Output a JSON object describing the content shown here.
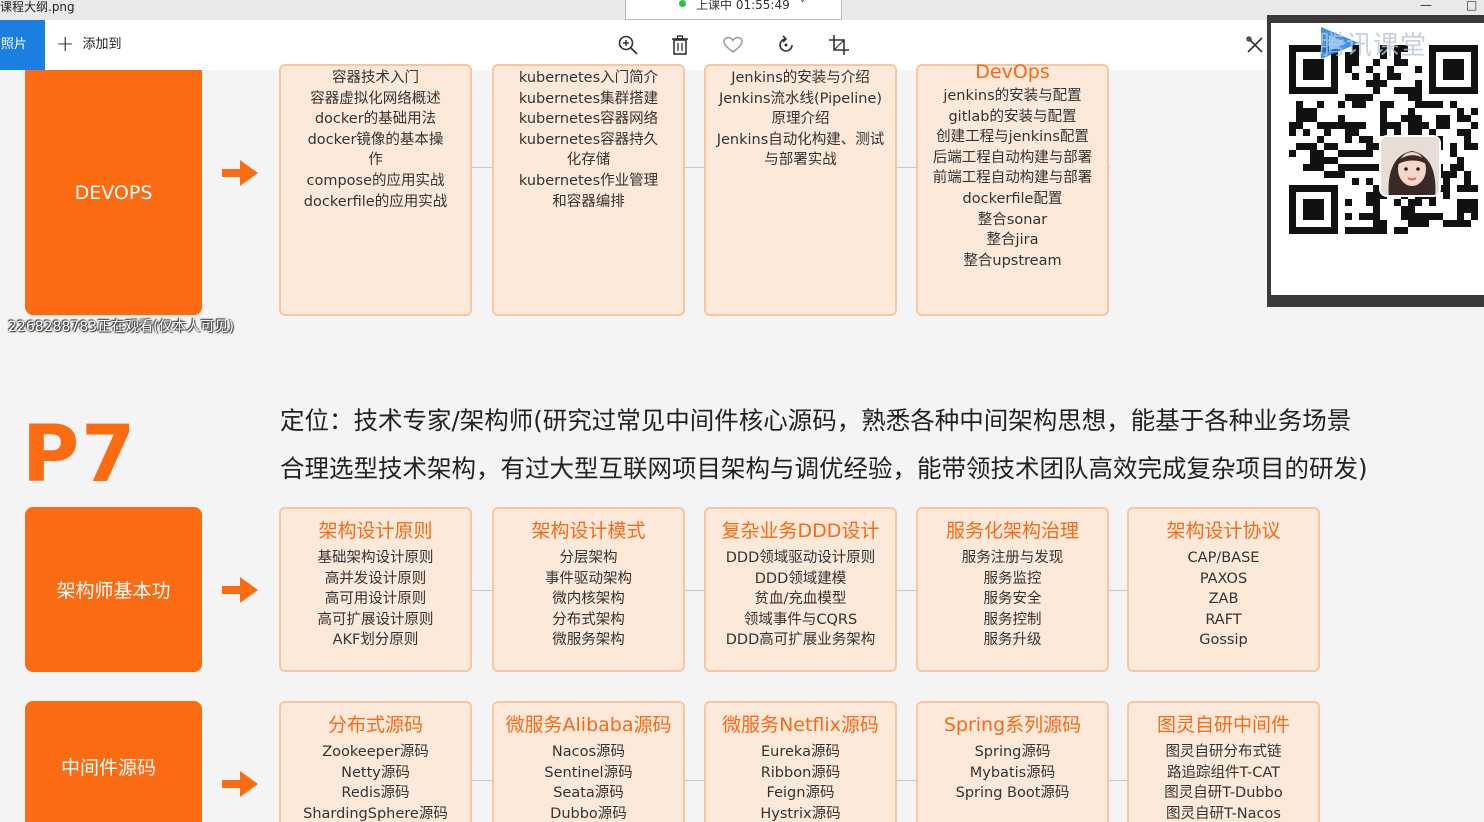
{
  "window": {
    "filename": "课程大纲.png",
    "minimize_glyph": "—",
    "maximize_glyph": "□"
  },
  "live": {
    "status": "上课中 01:55:49",
    "chevron": "˅"
  },
  "toolbar": {
    "tab_label": "有照片",
    "add_label": "添加到",
    "icons": [
      "zoom-in-icon",
      "trash-icon",
      "heart-icon",
      "rotate-icon",
      "crop-icon",
      "edit-icon"
    ]
  },
  "viewer_note": "2268288783正在观看(仅本人可见)",
  "qr_panel": {
    "brand": "腾讯课堂",
    "accent": "#1a7fe0"
  },
  "devops_row": {
    "label": "DEVOPS",
    "cards": [
      {
        "title": "",
        "items": [
          "容器技术入门",
          "容器虚拟化网络概述",
          "docker的基础用法",
          "docker镜像的基本操",
          "作",
          "compose的应用实战",
          "dockerfile的应用实战"
        ]
      },
      {
        "title": "",
        "items": [
          "kubernetes入门简介",
          "kubernetes集群搭建",
          "kubernetes容器网络",
          "kubernetes容器持久",
          "化存储",
          "kubernetes作业管理",
          "和容器编排"
        ]
      },
      {
        "title": "",
        "items": [
          "Jenkins的安装与介绍",
          "Jenkins流水线(Pipeline)",
          "原理介绍",
          "Jenkins自动化构建、测试",
          "与部署实战"
        ]
      },
      {
        "title": "DevOps",
        "items": [
          "jenkins的安装与配置",
          "gitlab的安装与配置",
          "创建工程与jenkins配置",
          "后端工程自动构建与部署",
          "前端工程自动构建与部署",
          "dockerfile配置",
          "整合sonar",
          "整合jira",
          "整合upstream"
        ]
      }
    ]
  },
  "level": {
    "name": "P7",
    "description_line1": "定位：技术专家/架构师(研究过常见中间件核心源码，熟悉各种中间架构思想，能基于各种业务场景",
    "description_line2": "合理选型技术架构，有过大型互联网项目架构与调优经验，能带领技术团队高效完成复杂项目的研发)"
  },
  "architect_row": {
    "label": "架构师基本功",
    "cards": [
      {
        "title": "架构设计原则",
        "items": [
          "基础架构设计原则",
          "高并发设计原则",
          "高可用设计原则",
          "高可扩展设计原则",
          "AKF划分原则"
        ]
      },
      {
        "title": "架构设计模式",
        "items": [
          "分层架构",
          "事件驱动架构",
          "微内核架构",
          "分布式架构",
          "微服务架构"
        ]
      },
      {
        "title": "复杂业务DDD设计",
        "items": [
          "DDD领域驱动设计原则",
          "DDD领域建模",
          "贫血/充血模型",
          "领域事件与CQRS",
          "DDD高可扩展业务架构"
        ]
      },
      {
        "title": "服务化架构治理",
        "items": [
          "服务注册与发现",
          "服务监控",
          "服务安全",
          "服务控制",
          "服务升级"
        ]
      },
      {
        "title": "架构设计协议",
        "items": [
          "CAP/BASE",
          "PAXOS",
          "ZAB",
          "RAFT",
          "Gossip"
        ]
      }
    ]
  },
  "middleware_row": {
    "label": "中间件源码",
    "cards": [
      {
        "title": "分布式源码",
        "items": [
          "Zookeeper源码",
          "Netty源码",
          "Redis源码",
          "ShardingSphere源码"
        ]
      },
      {
        "title": "微服务Alibaba源码",
        "items": [
          "Nacos源码",
          "Sentinel源码",
          "Seata源码",
          "Dubbo源码"
        ]
      },
      {
        "title": "微服务Netflix源码",
        "items": [
          "Eureka源码",
          "Ribbon源码",
          "Feign源码",
          "Hystrix源码"
        ]
      },
      {
        "title": "Spring系列源码",
        "items": [
          "Spring源码",
          "Mybatis源码",
          "Spring Boot源码"
        ]
      },
      {
        "title": "图灵自研中间件",
        "items": [
          "图灵自研分布式链",
          "路追踪组件T-CAT",
          "图灵自研T-Dubbo",
          "图灵自研T-Nacos"
        ]
      }
    ]
  },
  "colors": {
    "orange": "#fa6b12",
    "card_bg": "#fde9d9",
    "card_border": "#f7c6a2",
    "accent_blue": "#1a7fe0"
  }
}
